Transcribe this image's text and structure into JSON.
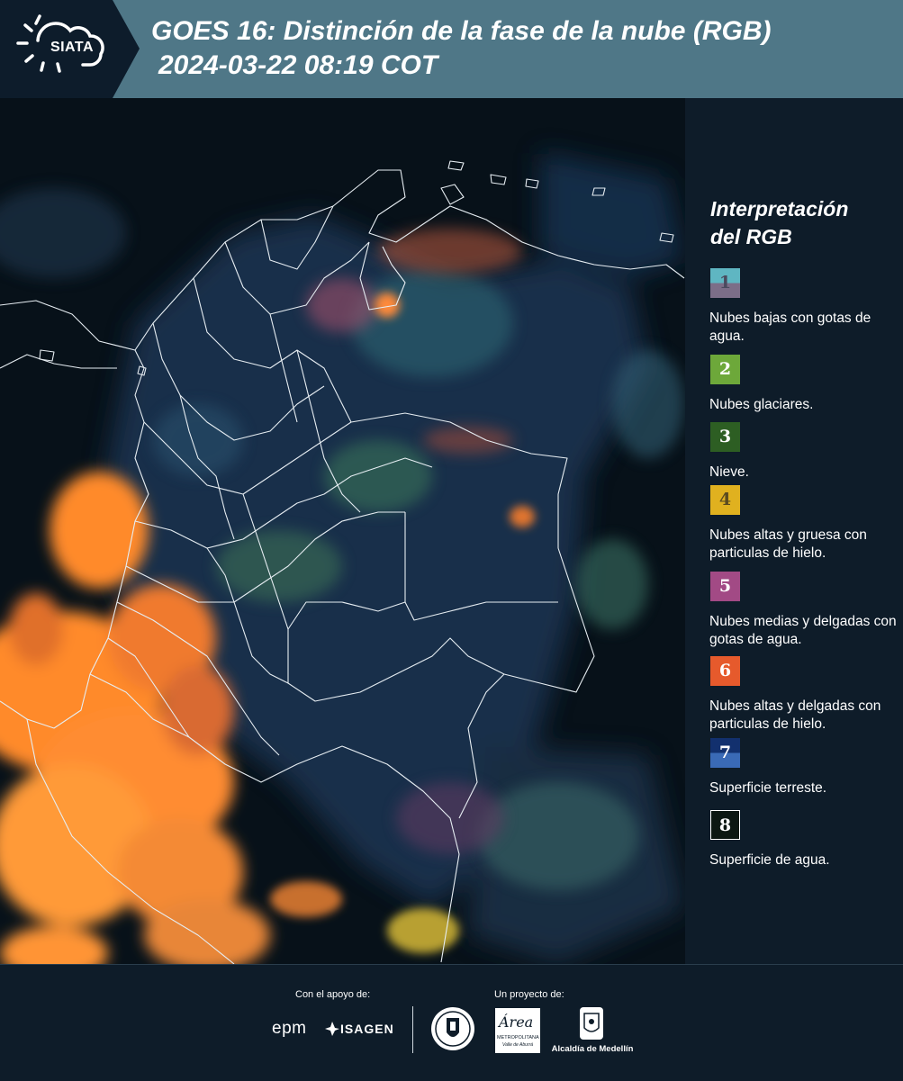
{
  "header": {
    "logo_text": "SIATA",
    "title": "GOES 16: Distinción de la fase de la nube (RGB)",
    "subtitle": "2024-03-22 08:19 COT"
  },
  "legend": {
    "title": "Interpretación\ndel RGB",
    "items": [
      {
        "number": "1",
        "label": "Nubes bajas con gotas de agua.",
        "color_top": "#5fb6c2",
        "color_bottom": "#7c6e88",
        "text_color": "#4a4a5e"
      },
      {
        "number": "2",
        "label": "Nubes glaciares.",
        "color_top": "#6da83a",
        "color_bottom": "#6da83a",
        "text_color": "#ffffff"
      },
      {
        "number": "3",
        "label": "Nieve.",
        "color_top": "#2d5e23",
        "color_bottom": "#2d5e23",
        "text_color": "#ffffff"
      },
      {
        "number": "4",
        "label": "Nubes altas y gruesa con particulas de hielo.",
        "color_top": "#e0b11f",
        "color_bottom": "#e0b11f",
        "text_color": "#5a4a20"
      },
      {
        "number": "5",
        "label": "Nubes medias y delgadas con gotas de agua.",
        "color_top": "#a24a85",
        "color_bottom": "#a24a85",
        "text_color": "#ffffff"
      },
      {
        "number": "6",
        "label": "Nubes altas y delgadas con particulas de hielo.",
        "color_top": "#e65a2c",
        "color_bottom": "#e65a2c",
        "text_color": "#ffffff"
      },
      {
        "number": "7",
        "label": "Superficie terreste.",
        "color_top": "#12306e",
        "color_bottom": "#3a6ab6",
        "text_color": "#ffffff"
      },
      {
        "number": "8",
        "label": "Superficie de agua.",
        "color_top": "#0c1712",
        "color_bottom": "#0c1712",
        "text_color": "#ffffff"
      }
    ]
  },
  "footer": {
    "support_caption": "Con el apoyo de:",
    "project_caption": "Un proyecto de:",
    "epm_logo": "epm",
    "isagen_logo": "ISAGEN",
    "area_logo": "Área",
    "area_sub1": "METROPOLITANA",
    "area_sub2": "Valle de Aburrá",
    "alcaldia_logo": "Alcaldía de Medellín"
  },
  "colors": {
    "header_bg": "#4f7787",
    "page_bg": "#0e1c29",
    "cloud_orange": "#ff8a2a"
  }
}
